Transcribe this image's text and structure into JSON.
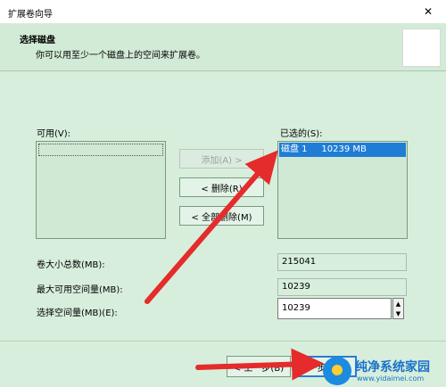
{
  "window": {
    "title": "扩展卷向导",
    "close_icon": "✕"
  },
  "header": {
    "title": "选择磁盘",
    "subtitle": "你可以用至少一个磁盘上的空间来扩展卷。"
  },
  "available": {
    "label": "可用(V):",
    "items": []
  },
  "selected": {
    "label": "已选的(S):",
    "items": [
      "磁盘 1     10239 MB"
    ]
  },
  "buttons": {
    "add": "添加(A) >",
    "remove": "< 删除(R)",
    "remove_all": "< 全部删除(M)"
  },
  "fields": {
    "total_label": "卷大小总数(MB):",
    "total_value": "215041",
    "max_label": "最大可用空间量(MB):",
    "max_value": "10239",
    "select_label": "选择空间量(MB)(E):",
    "select_value": "10239"
  },
  "footer": {
    "back": "< 上一步(B)",
    "next": "下一步(N) >"
  },
  "watermark": {
    "title": "纯净系统家园",
    "url": "www.yidaimei.com"
  },
  "colors": {
    "accent": "#1f7dd6",
    "arrow": "#e52b2b",
    "panel": "#d7eedc"
  }
}
